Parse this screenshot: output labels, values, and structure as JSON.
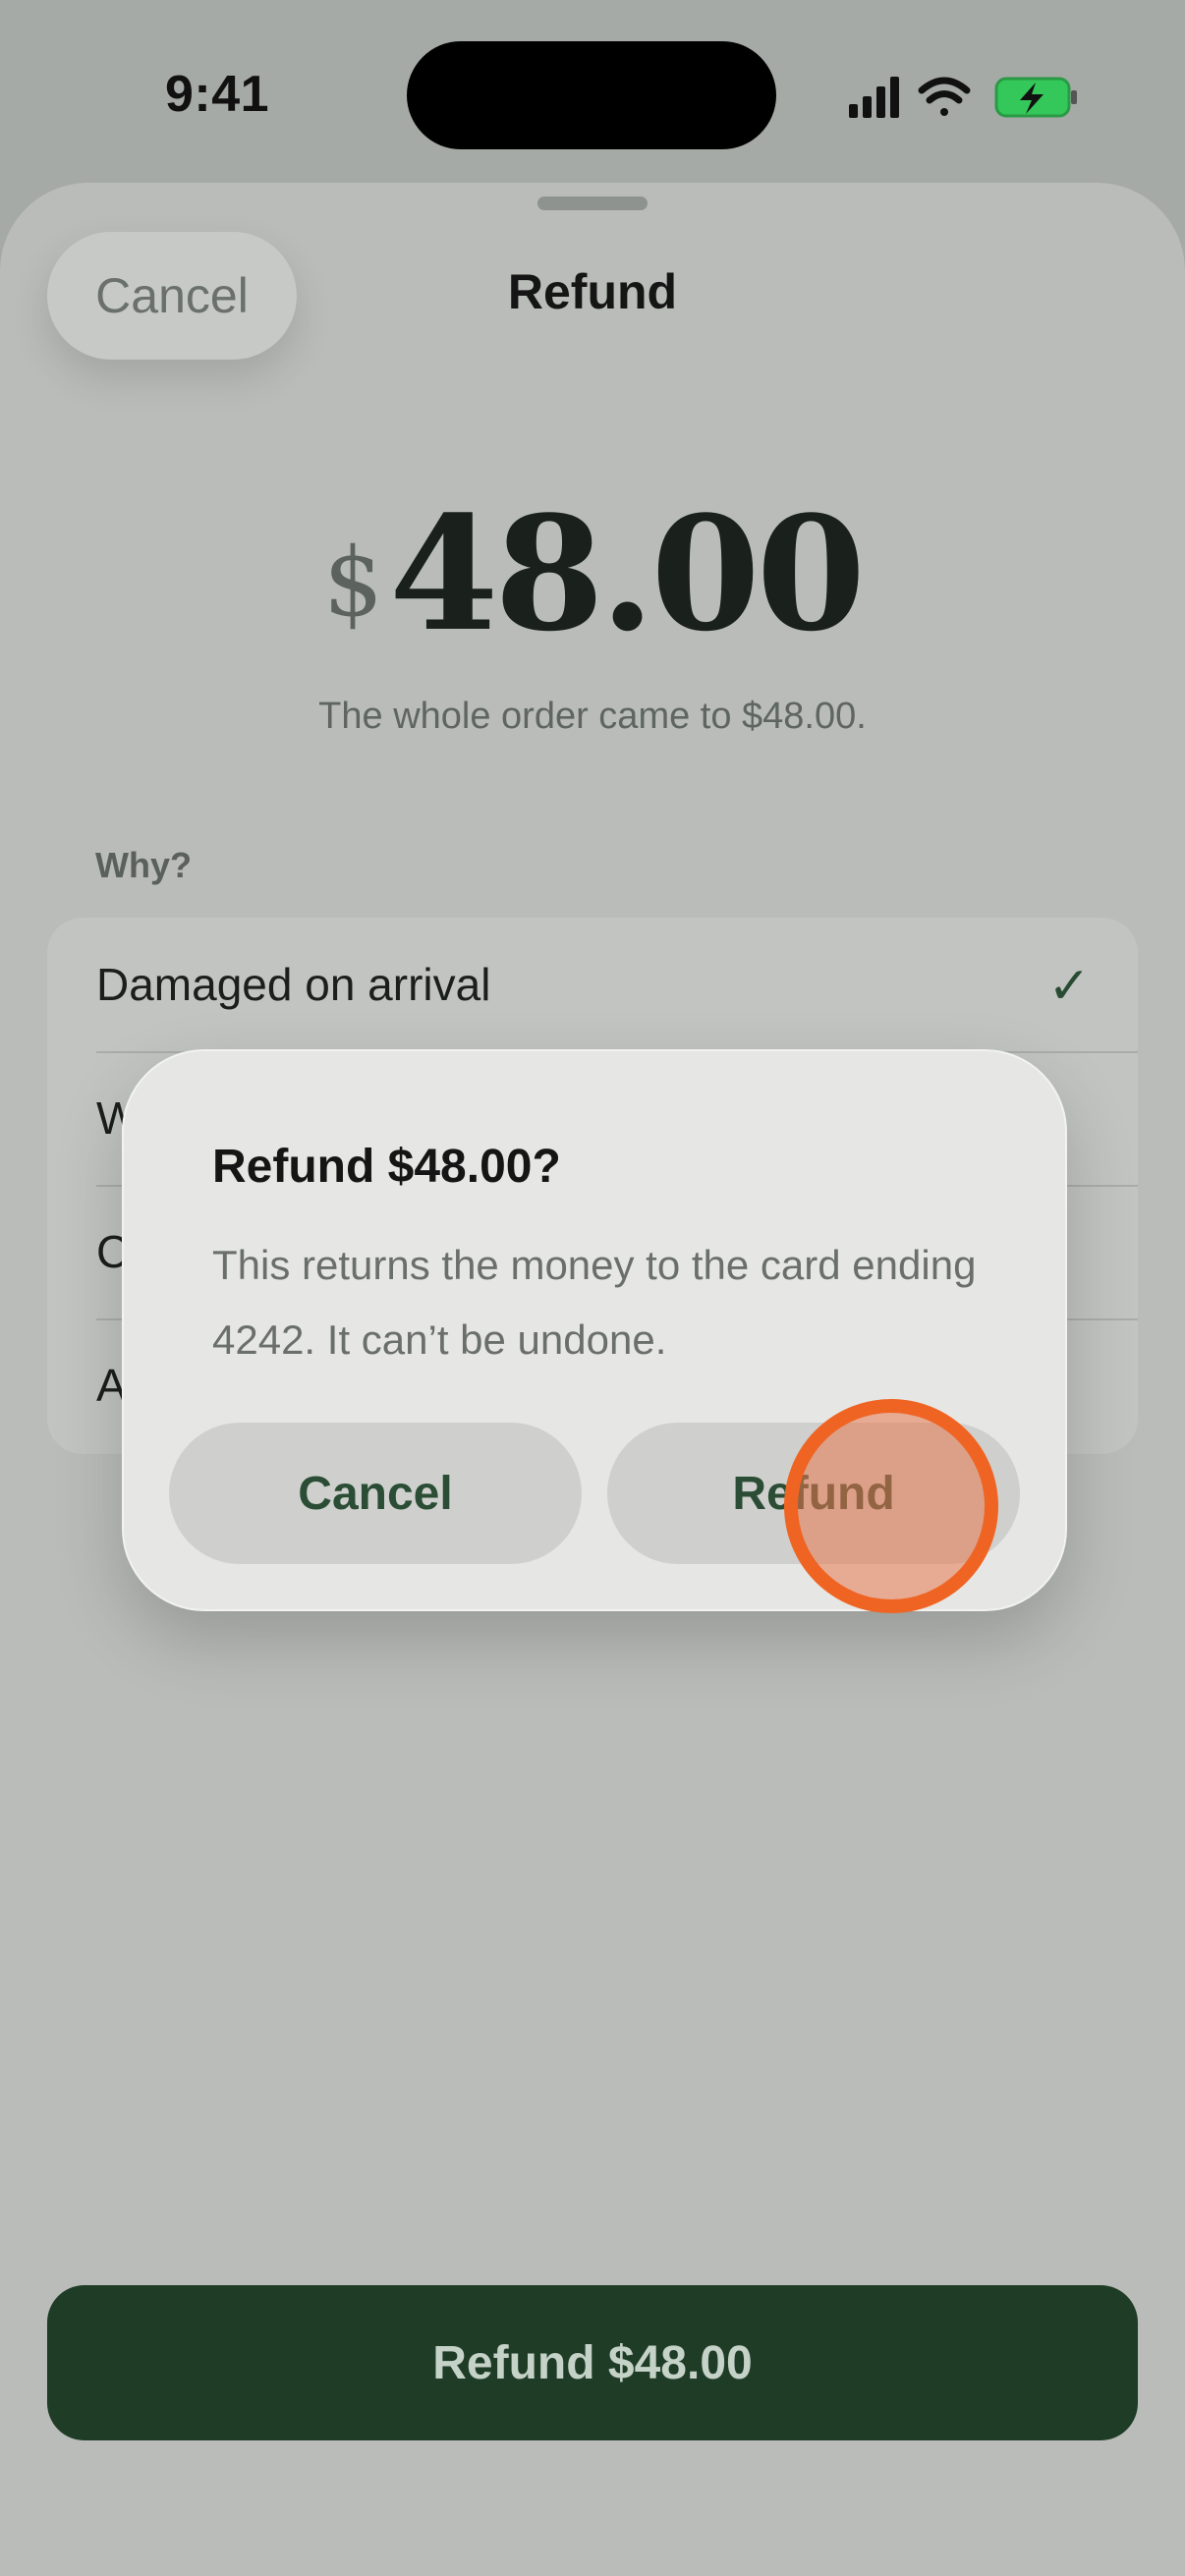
{
  "status_bar": {
    "time": "9:41",
    "icons": [
      "signal-icon",
      "wifi-icon",
      "battery-charging-icon"
    ]
  },
  "header": {
    "cancel_label": "Cancel",
    "title": "Refund"
  },
  "amount": {
    "currency": "$",
    "value": "48.00",
    "note": "The whole order came to $48.00."
  },
  "reasons": {
    "heading": "Why?",
    "items": [
      {
        "label": "Damaged on arrival",
        "selected": true
      },
      {
        "label": "W",
        "selected": false
      },
      {
        "label": "C",
        "selected": false
      },
      {
        "label": "A",
        "selected": false
      }
    ]
  },
  "dialog": {
    "title": "Refund $48.00?",
    "body": "This returns the money to the card ending 4242. It can’t be undone.",
    "cancel_label": "Cancel",
    "confirm_label": "Refund"
  },
  "primary_action": {
    "label": "Refund $48.00"
  },
  "colors": {
    "accent": "#1f3c27",
    "tap_indicator": "#ef6422",
    "battery": "#34c759"
  }
}
